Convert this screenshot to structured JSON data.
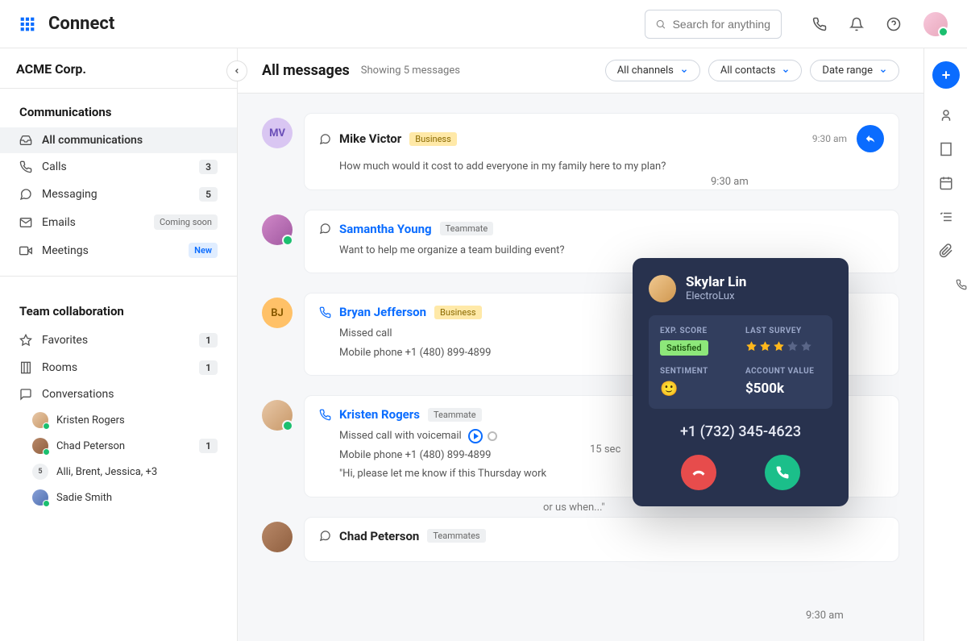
{
  "header": {
    "brand": "Connect",
    "search_placeholder": "Search for anything"
  },
  "sidebar": {
    "company": "ACME Corp.",
    "sections": {
      "communications": {
        "title": "Communications",
        "items": [
          {
            "id": "all-comms",
            "label": "All communications",
            "active": true
          },
          {
            "id": "calls",
            "label": "Calls",
            "count": "3"
          },
          {
            "id": "messaging",
            "label": "Messaging",
            "count": "5"
          },
          {
            "id": "emails",
            "label": "Emails",
            "badge": "Coming soon"
          },
          {
            "id": "meetings",
            "label": "Meetings",
            "badge": "New"
          }
        ]
      },
      "team": {
        "title": "Team collaboration",
        "items": [
          {
            "id": "favorites",
            "label": "Favorites",
            "count": "1"
          },
          {
            "id": "rooms",
            "label": "Rooms",
            "count": "1"
          },
          {
            "id": "conversations",
            "label": "Conversations"
          }
        ],
        "conversations": [
          {
            "label": "Kristen Rogers",
            "online": true
          },
          {
            "label": "Chad Peterson",
            "online": true,
            "count": "1"
          },
          {
            "label": "Alli, Brent, Jessica, +3",
            "group": true,
            "group_count": "5"
          },
          {
            "label": "Sadie Smith",
            "online": true
          }
        ]
      }
    }
  },
  "main": {
    "title": "All messages",
    "subtitle": "Showing 5 messages",
    "filters": [
      "All channels",
      "All contacts",
      "Date range"
    ]
  },
  "messages": [
    {
      "avatar_initials": "MV",
      "avatar_bg": "#d9c6f2",
      "type": "chat",
      "name": "Mike Victor",
      "name_link": false,
      "tag": "Business",
      "tag_class": "tag-business",
      "time": "9:30 am",
      "reply": true,
      "lines": [
        "How much would it cost to add everyone in my family here to my plan?"
      ]
    },
    {
      "avatar_bg": "linear-gradient(135deg,#d088c8,#a058a0)",
      "online": true,
      "type": "chat",
      "name": "Samantha Young",
      "name_link": true,
      "tag": "Teammate",
      "tag_class": "tag-teammate",
      "lines": [
        "Want to help me organize a team building event?"
      ]
    },
    {
      "avatar_initials": "BJ",
      "avatar_bg": "#ffc168",
      "type": "phone",
      "name": "Bryan Jefferson",
      "name_link": true,
      "tag": "Business",
      "tag_class": "tag-business",
      "lines": [
        "Missed call",
        "Mobile phone +1 (480) 899-4899"
      ]
    },
    {
      "avatar_bg": "linear-gradient(135deg,#e8c8a8,#c89868)",
      "online": true,
      "type": "phone",
      "name": "Kristen Rogers",
      "name_link": true,
      "tag": "Teammate",
      "tag_class": "tag-teammate",
      "voicemail": true,
      "lines": [
        "Missed call with voicemail",
        "Mobile phone +1 (480) 899-4899",
        "\"Hi, please let me know if this Thursday work"
      ]
    },
    {
      "avatar_bg": "linear-gradient(135deg,#b88868,#906040)",
      "type": "chat",
      "name": "Chad Peterson",
      "name_link": false,
      "tag": "Teammates",
      "tag_class": "tag-teammate",
      "lines": []
    }
  ],
  "call_popup": {
    "name": "Skylar Lin",
    "company": "ElectroLux",
    "exp_score_label": "EXP. SCORE",
    "exp_score_value": "Satisfied",
    "last_survey_label": "LAST SURVEY",
    "last_survey_stars": 3,
    "sentiment_label": "SENTIMENT",
    "sentiment_emoji": "🙂",
    "account_value_label": "ACCOUNT VALUE",
    "account_value": "$500k",
    "phone": "+1 (732) 345-4623"
  },
  "background_fragments": {
    "time1": "9:30 am",
    "dur": "15 sec",
    "quote": "or us when...\"",
    "time2": "9:30 am"
  }
}
